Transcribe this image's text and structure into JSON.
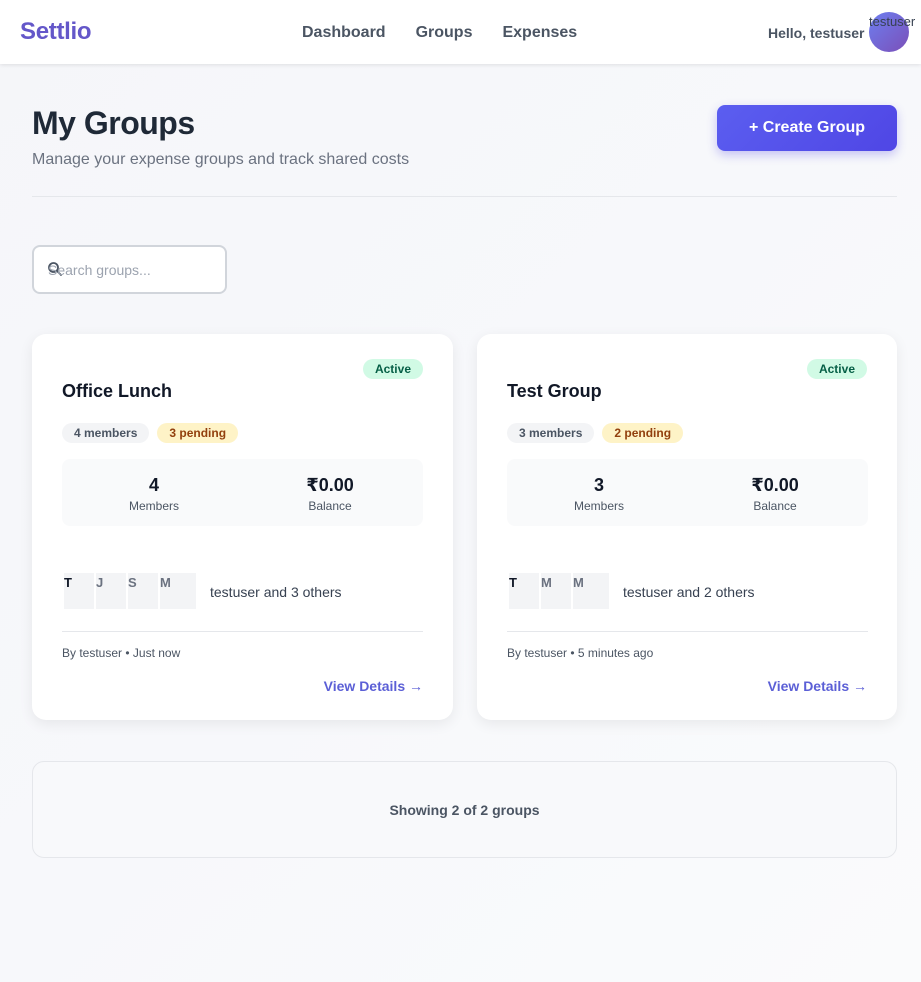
{
  "nav": {
    "brand": "Settlio",
    "links": [
      "Dashboard",
      "Groups",
      "Expenses"
    ],
    "greeting": "Hello, testuser",
    "avatar_label": "testuser"
  },
  "header": {
    "title": "My Groups",
    "subtitle": "Manage your expense groups and track shared costs",
    "create_label": "+ Create Group"
  },
  "search": {
    "placeholder": "Search groups..."
  },
  "groups": [
    {
      "status": "Active",
      "name": "Office Lunch",
      "members_chip": "4 members",
      "pending_chip": "3 pending",
      "members_value": "4",
      "members_label": "Members",
      "balance_value": "₹0.00",
      "balance_label": "Balance",
      "initials": [
        "T",
        "J",
        "S",
        "M"
      ],
      "others": "testuser and 3 others",
      "meta": "By testuser • Just now",
      "view_label": "View Details →"
    },
    {
      "status": "Active",
      "name": "Test Group",
      "members_chip": "3 members",
      "pending_chip": "2 pending",
      "members_value": "3",
      "members_label": "Members",
      "balance_value": "₹0.00",
      "balance_label": "Balance",
      "initials": [
        "T",
        "M",
        "M"
      ],
      "others": "testuser and 2 others",
      "meta": "By testuser • 5 minutes ago",
      "view_label": "View Details →"
    }
  ],
  "summary": "Showing 2 of 2 groups",
  "colors": {
    "brand": "#6457c9",
    "primary_button": "#4f46e5",
    "active_badge_bg": "#d1fae5",
    "pending_chip_bg": "#fef3c7",
    "link": "#5b5fd6"
  }
}
